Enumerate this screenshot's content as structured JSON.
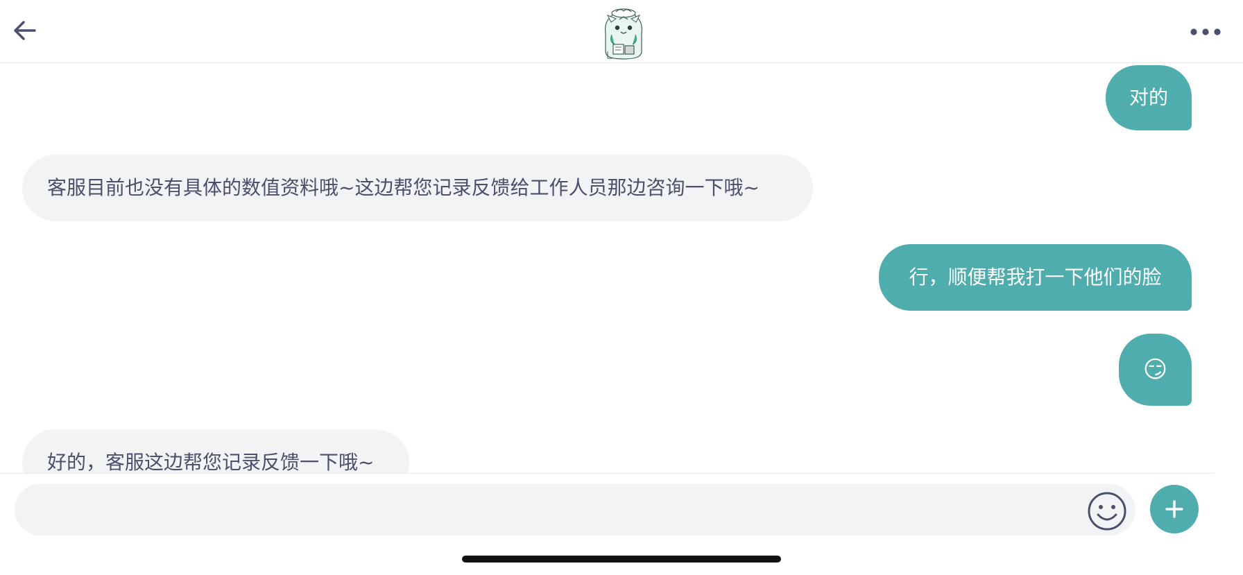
{
  "header": {
    "back_icon": "arrow-left-icon",
    "avatar_icon": "cartoon-mascot-avatar",
    "more_icon": "more-horizontal-icon"
  },
  "messages": [
    {
      "side": "outgoing",
      "text": "对的"
    },
    {
      "side": "incoming",
      "text": "客服目前也没有具体的数值资料哦~这边帮您记录反馈给工作人员那边咨询一下哦~"
    },
    {
      "side": "outgoing",
      "text": "行，顺便帮我打一下他们的脸"
    },
    {
      "side": "outgoing",
      "text": "😏"
    },
    {
      "side": "incoming",
      "text": "好的，客服这边帮您记录反馈一下哦~"
    }
  ],
  "composer": {
    "value": "",
    "emoji_icon": "smiley-icon",
    "plus_icon": "plus-icon"
  },
  "colors": {
    "accent": "#4fadae",
    "incoming_bubble": "#f2f3f5",
    "text_dark": "#4b4f6b"
  }
}
